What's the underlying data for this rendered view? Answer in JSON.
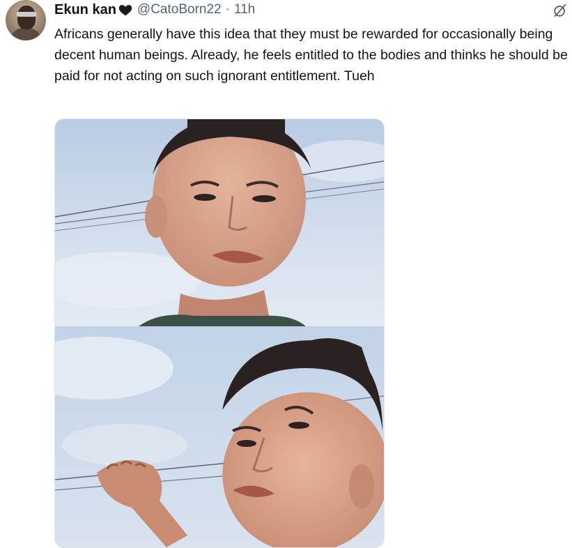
{
  "tweet": {
    "author_name": "Ekun kan",
    "handle": "@CatoBorn22",
    "separator": "·",
    "time": "11h",
    "text": "Africans generally have this idea that they must be rewarded for occasionally being decent human beings. Already, he feels entitled to the bodies and thinks he should be paid for not acting on such ignorant entitlement. Tueh",
    "icons": {
      "heart": "black-heart-icon",
      "grok": "grok-icon"
    }
  },
  "media": {
    "panels": [
      "meme-panel-top",
      "meme-panel-bottom"
    ]
  },
  "colors": {
    "text_primary": "#0f1419",
    "text_secondary": "#536471",
    "sky": "#cfdcec"
  }
}
